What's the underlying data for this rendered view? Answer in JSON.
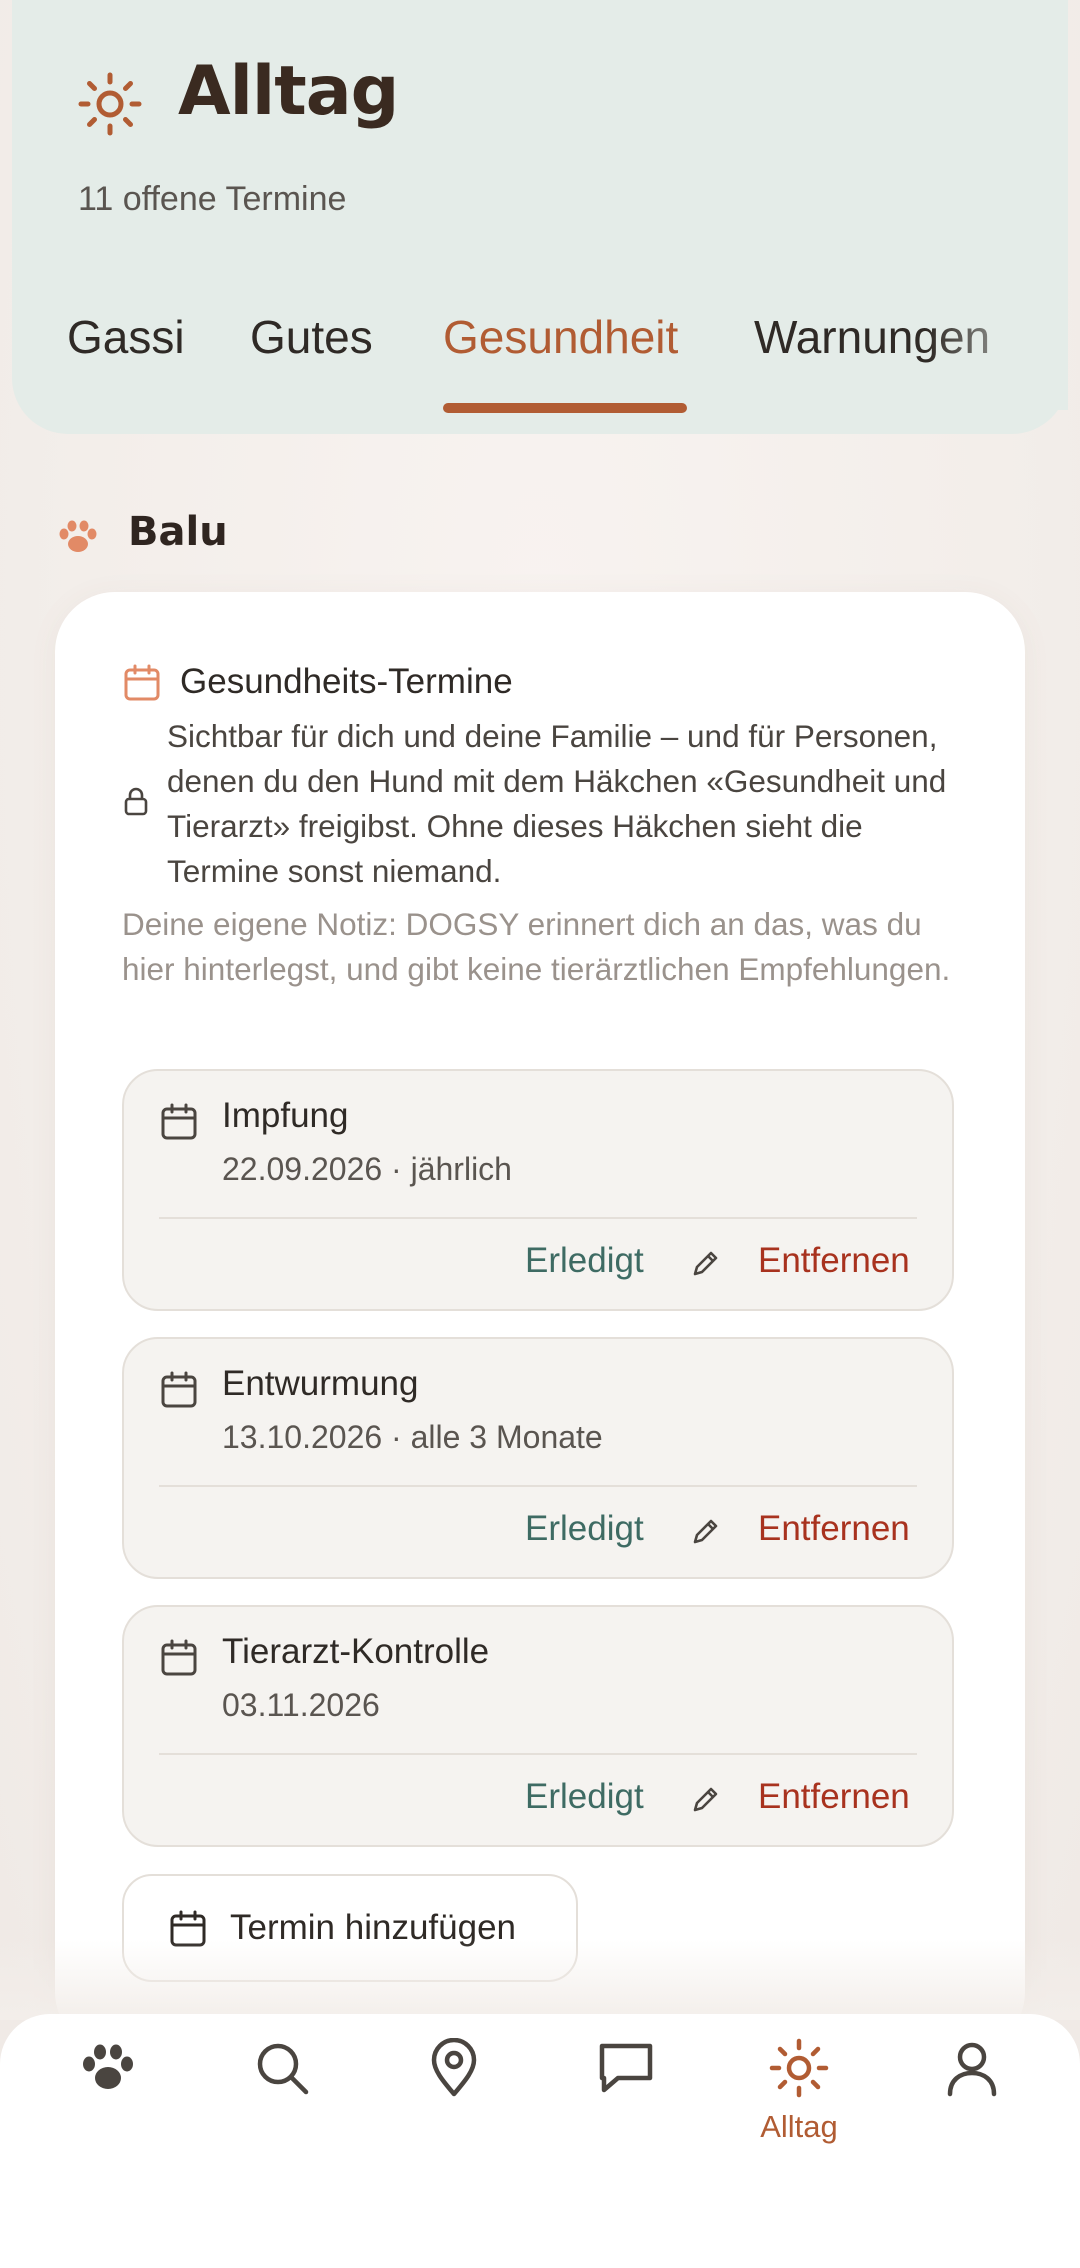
{
  "header": {
    "title": "Alltag",
    "subtitle": "11 offene Termine",
    "tabs": [
      {
        "label": "Gassi"
      },
      {
        "label": "Gutes"
      },
      {
        "label": "Gesundheit"
      },
      {
        "label": "Warnungen"
      }
    ],
    "active_tab": "Gesundheit"
  },
  "dog": {
    "name": "Balu"
  },
  "card": {
    "title": "Gesundheits-Termine",
    "privacy_text": "Sichtbar für dich und deine Familie – und für Personen, denen du den Hund mit dem Häkchen «Gesundheit und Tierarzt» freigibst. Ohne dieses Häkchen sieht die Termine sonst niemand.",
    "note": "Deine eigene Notiz: DOGSY erinnert dich an das, was du hier hinterlegst, und gibt keine tierärztlichen Empfehlungen.",
    "appointments": [
      {
        "name": "Impfung",
        "date": "22.09.2026 · jährlich",
        "done_label": "Erledigt",
        "remove_label": "Entfernen"
      },
      {
        "name": "Entwurmung",
        "date": "13.10.2026 · alle 3 Monate",
        "done_label": "Erledigt",
        "remove_label": "Entfernen"
      },
      {
        "name": "Tierarzt-Kontrolle",
        "date": "03.11.2026",
        "done_label": "Erledigt",
        "remove_label": "Entfernen"
      }
    ],
    "add_label": "Termin hinzufügen"
  },
  "nav": {
    "items": [
      {
        "icon": "paw-icon"
      },
      {
        "icon": "search-icon"
      },
      {
        "icon": "map-pin-icon"
      },
      {
        "icon": "chat-icon"
      },
      {
        "icon": "sun-icon",
        "label": "Alltag"
      },
      {
        "icon": "profile-icon"
      }
    ],
    "active": "Alltag"
  },
  "colors": {
    "accent": "#b15c33",
    "header_bg": "#e4ece8",
    "done": "#3e6b63",
    "remove": "#a8321e"
  }
}
